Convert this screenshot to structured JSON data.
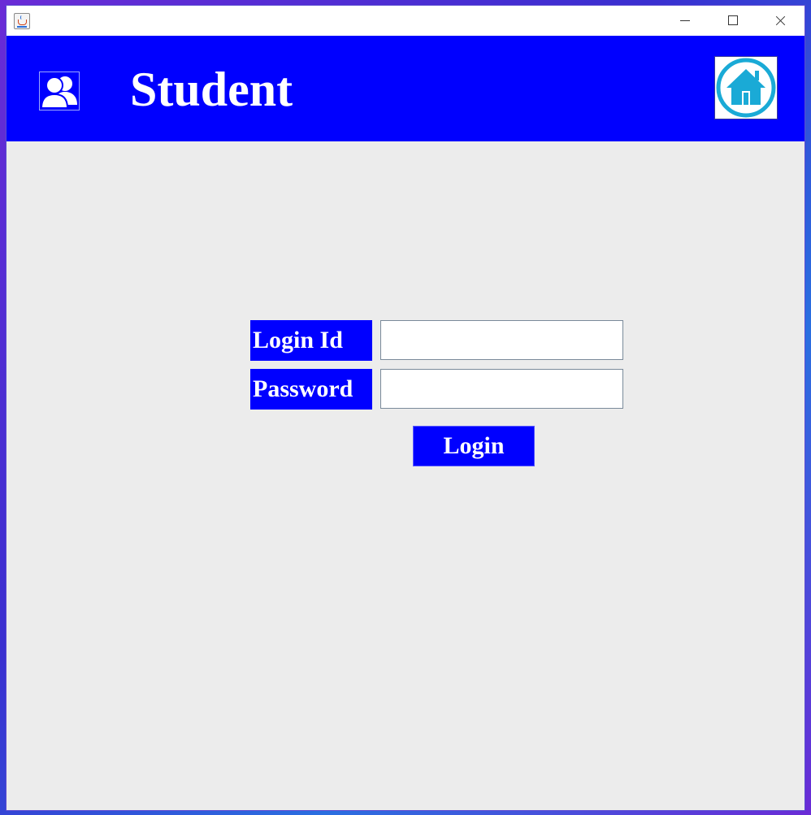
{
  "window": {
    "title": "",
    "controls": {
      "minimize": "minimize",
      "maximize": "maximize",
      "close": "close"
    }
  },
  "header": {
    "title": "Student",
    "left_icon": "users-icon",
    "home_icon": "home-icon",
    "background_color": "#0000ff"
  },
  "form": {
    "login_id_label": "Login Id",
    "login_id_value": "",
    "password_label": "Password",
    "password_value": "",
    "login_button_label": "Login"
  },
  "colors": {
    "accent": "#0000ff",
    "home_icon": "#1aaad6",
    "panel": "#ececec"
  }
}
